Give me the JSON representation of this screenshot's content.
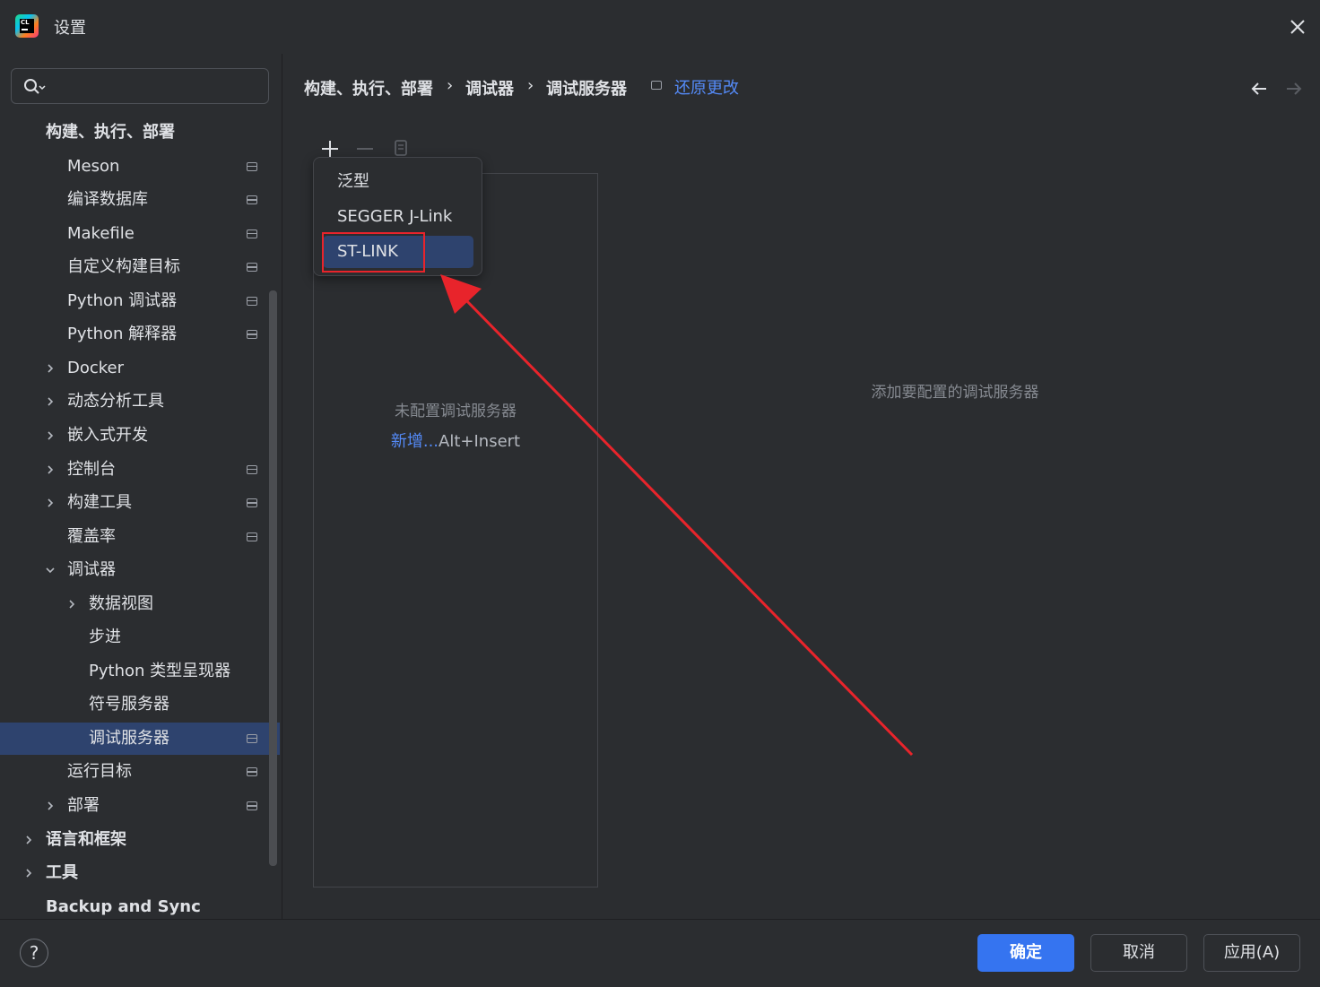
{
  "window": {
    "title": "设置",
    "close_icon": "close-icon",
    "app_icon": "clion-logo"
  },
  "search": {
    "icon": "search-icon",
    "placeholder": ""
  },
  "sidebar": {
    "items": [
      {
        "label": "构建、执行、部署",
        "level": 0,
        "bold": true,
        "chevron": "none",
        "page_icon": false,
        "selected": false
      },
      {
        "label": "Meson",
        "level": 1,
        "chevron": "none",
        "page_icon": true,
        "selected": false
      },
      {
        "label": "编译数据库",
        "level": 1,
        "chevron": "none",
        "page_icon": true,
        "selected": false
      },
      {
        "label": "Makefile",
        "level": 1,
        "chevron": "none",
        "page_icon": true,
        "selected": false
      },
      {
        "label": "自定义构建目标",
        "level": 1,
        "chevron": "none",
        "page_icon": true,
        "selected": false
      },
      {
        "label": "Python 调试器",
        "level": 1,
        "chevron": "none",
        "page_icon": true,
        "selected": false
      },
      {
        "label": "Python 解释器",
        "level": 1,
        "chevron": "none",
        "page_icon": true,
        "selected": false
      },
      {
        "label": "Docker",
        "level": 1,
        "chevron": "right",
        "page_icon": false,
        "selected": false
      },
      {
        "label": "动态分析工具",
        "level": 1,
        "chevron": "right",
        "page_icon": false,
        "selected": false
      },
      {
        "label": "嵌入式开发",
        "level": 1,
        "chevron": "right",
        "page_icon": false,
        "selected": false
      },
      {
        "label": "控制台",
        "level": 1,
        "chevron": "right",
        "page_icon": true,
        "selected": false
      },
      {
        "label": "构建工具",
        "level": 1,
        "chevron": "right",
        "page_icon": true,
        "selected": false
      },
      {
        "label": "覆盖率",
        "level": 1,
        "chevron": "none",
        "page_icon": true,
        "selected": false
      },
      {
        "label": "调试器",
        "level": 1,
        "chevron": "down",
        "page_icon": false,
        "selected": false
      },
      {
        "label": "数据视图",
        "level": 2,
        "chevron": "right",
        "page_icon": false,
        "selected": false
      },
      {
        "label": "步进",
        "level": 2,
        "chevron": "none",
        "page_icon": false,
        "selected": false
      },
      {
        "label": "Python 类型呈现器",
        "level": 2,
        "chevron": "none",
        "page_icon": false,
        "selected": false
      },
      {
        "label": "符号服务器",
        "level": 2,
        "chevron": "none",
        "page_icon": false,
        "selected": false
      },
      {
        "label": "调试服务器",
        "level": 2,
        "chevron": "none",
        "page_icon": true,
        "selected": true
      },
      {
        "label": "运行目标",
        "level": 1,
        "chevron": "none",
        "page_icon": true,
        "selected": false
      },
      {
        "label": "部署",
        "level": 1,
        "chevron": "right",
        "page_icon": true,
        "selected": false
      },
      {
        "label": "语言和框架",
        "level": 0,
        "bold": true,
        "chevron": "right",
        "page_icon": false,
        "selected": false
      },
      {
        "label": "工具",
        "level": 0,
        "bold": true,
        "chevron": "right",
        "page_icon": false,
        "selected": false
      },
      {
        "label": "Backup and Sync",
        "level": 0,
        "bold": true,
        "chevron": "none",
        "page_icon": false,
        "selected": false
      }
    ]
  },
  "breadcrumb": {
    "items": [
      "构建、执行、部署",
      "调试器",
      "调试服务器"
    ],
    "separator": "›",
    "reset_label": "还原更改"
  },
  "nav": {
    "back_icon": "arrow-left-icon",
    "forward_icon": "arrow-right-icon"
  },
  "toolbar": {
    "add_icon": "plus-icon",
    "remove_icon": "minus-icon",
    "copy_icon": "copy-icon"
  },
  "server_list": {
    "empty_text": "未配置调试服务器",
    "add_link": "新增...",
    "add_shortcut": "Alt+Insert"
  },
  "detail": {
    "hint": "添加要配置的调试服务器"
  },
  "popup": {
    "items": [
      {
        "label": "泛型",
        "selected": false
      },
      {
        "label": "SEGGER J-Link",
        "selected": false
      },
      {
        "label": "ST-LINK",
        "selected": true
      }
    ]
  },
  "footer": {
    "help": "?",
    "ok_label": "确定",
    "cancel_label": "取消",
    "apply_label": "应用(A)"
  },
  "colors": {
    "accent": "#3574f0",
    "link": "#548af7",
    "selection": "#2e436e",
    "annotation": "#e8242b"
  }
}
